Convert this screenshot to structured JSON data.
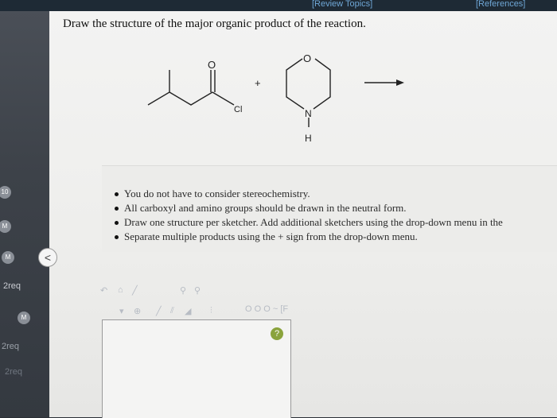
{
  "header": {
    "review_topics": "[Review Topics]",
    "references": "[References]"
  },
  "question": {
    "instruction": "Draw the structure of the major organic product of the reaction."
  },
  "reaction": {
    "plus": "+",
    "oxygen_label": "O",
    "chlorine_label": "Cl",
    "ring_oxygen_label": "O",
    "ring_nitrogen_label": "N",
    "hydrogen_label": "H"
  },
  "notes": [
    "You do not have to consider stereochemistry.",
    "All carboxyl and amino groups should be drawn in the neutral form.",
    "Draw one structure per sketcher. Add additional sketchers using the drop-down menu in the",
    "Separate multiple products using the + sign from the drop-down menu."
  ],
  "sidebar": {
    "badges": [
      "10",
      "M",
      "M",
      "M"
    ],
    "labels": [
      "2req",
      "2req",
      "2req"
    ],
    "collapse": "<"
  },
  "toolbar": {
    "row2_text": "O O O ~ [F"
  },
  "sketcher": {
    "help": "?"
  },
  "colors": {
    "link": "#6fa7d6",
    "help_button": "#8aa33c",
    "badge": "#8a8f97"
  }
}
